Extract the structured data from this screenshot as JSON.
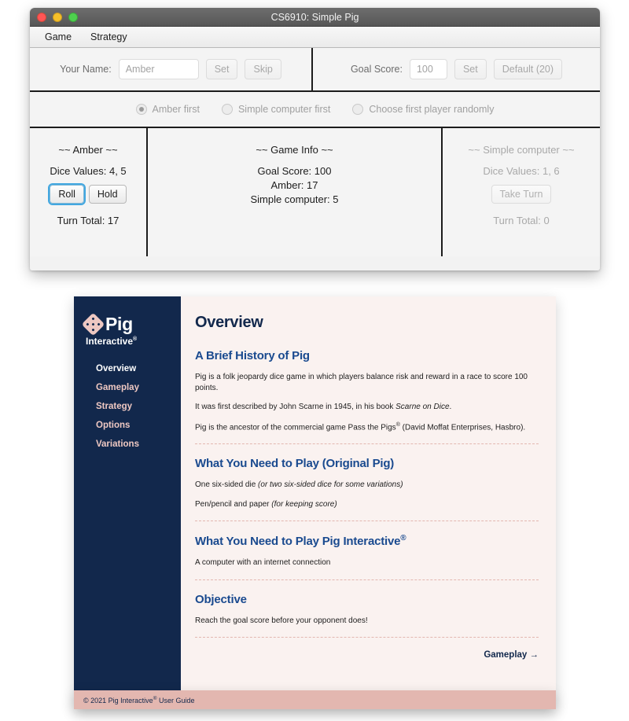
{
  "app": {
    "title": "CS6910: Simple Pig",
    "menus": [
      "Game",
      "Strategy"
    ],
    "setup": {
      "name_label": "Your Name:",
      "name_value": "Amber",
      "name_set": "Set",
      "name_skip": "Skip",
      "goal_label": "Goal Score:",
      "goal_value": "100",
      "goal_set": "Set",
      "goal_default": "Default (20)"
    },
    "first_player_options": [
      {
        "label": "Amber first",
        "selected": true
      },
      {
        "label": "Simple computer first",
        "selected": false
      },
      {
        "label": "Choose first player randomly",
        "selected": false
      }
    ],
    "player_panel": {
      "title": "~~ Amber ~~",
      "dice_line": "Dice Values: 4, 5",
      "roll_label": "Roll",
      "hold_label": "Hold",
      "turn_total": "Turn Total: 17"
    },
    "info_panel": {
      "title": "~~ Game Info ~~",
      "goal_score": "Goal Score: 100",
      "player_score": "Amber: 17",
      "computer_score": "Simple computer: 5"
    },
    "computer_panel": {
      "title": "~~ Simple computer ~~",
      "dice_line": "Dice Values: 1, 6",
      "take_turn_label": "Take Turn",
      "turn_total": "Turn Total: 0"
    }
  },
  "guide": {
    "logo": {
      "name": "Pig",
      "sub": "Interactive",
      "sub_mark": "®"
    },
    "nav": [
      {
        "label": "Overview",
        "active": true
      },
      {
        "label": "Gameplay",
        "active": false
      },
      {
        "label": "Strategy",
        "active": false
      },
      {
        "label": "Options",
        "active": false
      },
      {
        "label": "Variations",
        "active": false
      }
    ],
    "page_title": "Overview",
    "sections": {
      "history": {
        "heading": "A Brief History of Pig",
        "p1": "Pig is a folk jeopardy dice game in which players balance risk and reward in a race to score 100 points.",
        "p2_a": "It was first described by John Scarne in 1945, in his book ",
        "p2_em": "Scarne on Dice",
        "p2_b": ".",
        "p3_a": "Pig is the ancestor of the commercial game Pass the Pigs",
        "p3_sup": "®",
        "p3_b": " (David Moffat Enterprises, Hasbro)."
      },
      "need_original": {
        "heading": "What You Need to Play (Original Pig)",
        "item1_a": "One six-sided die ",
        "item1_em": "(or two six-sided dice for some variations)",
        "item2_a": "Pen/pencil and paper ",
        "item2_em": "(for keeping score)"
      },
      "need_interactive": {
        "heading_a": "What You Need to Play Pig Interactive",
        "heading_sup": "®",
        "item1": "A computer with an internet connection"
      },
      "objective": {
        "heading": "Objective",
        "item1": "Reach the goal score before your opponent does!"
      }
    },
    "next_link": "Gameplay →",
    "footer_a": "© 2021 Pig Interactive",
    "footer_sup": "®",
    "footer_b": " User Guide"
  }
}
